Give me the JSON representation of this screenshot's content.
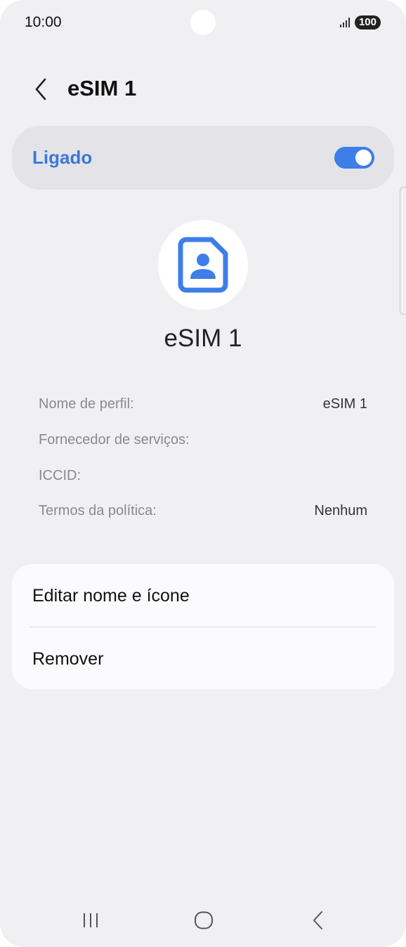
{
  "status_bar": {
    "time": "10:00",
    "battery": "100",
    "icons": [
      "signal-icon",
      "battery-icon"
    ]
  },
  "header": {
    "title": "eSIM 1",
    "back_icon": "chevron-left-icon"
  },
  "toggle": {
    "label": "Ligado",
    "state": "on",
    "accent_color": "#3d7ee9",
    "label_color": "#3d78d8"
  },
  "profile": {
    "icon": "sim-card-person-icon",
    "name": "eSIM 1"
  },
  "details": [
    {
      "label": "Nome de perfil:",
      "value": "eSIM 1"
    },
    {
      "label": "Fornecedor de serviços:",
      "value": ""
    },
    {
      "label": "ICCID:",
      "value": ""
    },
    {
      "label": "Termos da política:",
      "value": "Nenhum"
    }
  ],
  "actions": [
    {
      "label": "Editar nome e ícone"
    },
    {
      "label": "Remover"
    }
  ],
  "nav_bar": {
    "icons": [
      "recents-icon",
      "home-icon",
      "back-icon"
    ]
  }
}
